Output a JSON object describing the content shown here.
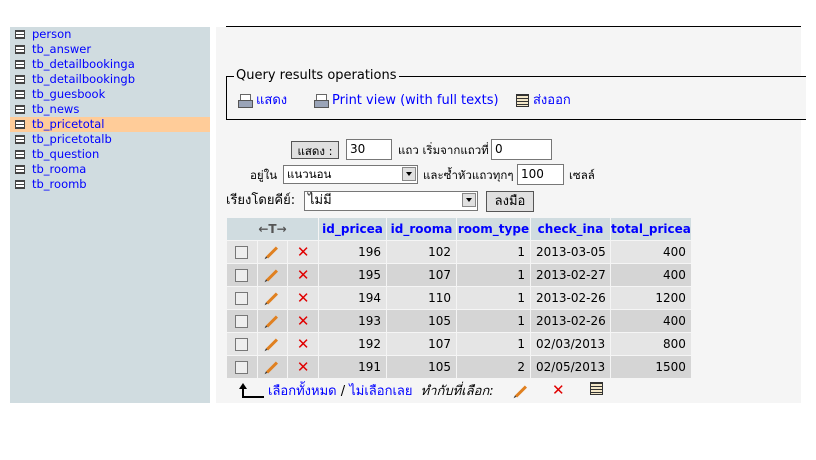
{
  "sidebar": {
    "items": [
      {
        "label": "person"
      },
      {
        "label": "tb_answer"
      },
      {
        "label": "tb_detailbookinga"
      },
      {
        "label": "tb_detailbookingb"
      },
      {
        "label": "tb_guesbook"
      },
      {
        "label": "tb_news"
      },
      {
        "label": "tb_pricetotal",
        "active": true
      },
      {
        "label": "tb_pricetotalb"
      },
      {
        "label": "tb_question"
      },
      {
        "label": "tb_rooma"
      },
      {
        "label": "tb_roomb"
      }
    ]
  },
  "query_ops": {
    "legend": "Query results operations",
    "links": [
      {
        "label": "แสดง",
        "icon": "print-icon"
      },
      {
        "label": "Print view (with full texts)",
        "icon": "print-icon"
      },
      {
        "label": "ส่งออก",
        "icon": "export-icon"
      }
    ]
  },
  "controls": {
    "show_button": "แสดง :",
    "rows_value": "30",
    "rows_label": "แถว เริ่มจากแถวที่",
    "start_value": "0",
    "mode_label": "อยู่ใน",
    "mode_value": "แนวนอน",
    "repeat_label": "และซ้ำหัวแถวทุกๆ",
    "repeat_value": "100",
    "cells_label": "เซลล์",
    "sort_label": "เรียงโดยคีย์:",
    "sort_value": "ไม่มี",
    "go_button": "ลงมือ"
  },
  "table": {
    "nav_arrows": "←T→",
    "columns": [
      "id_pricea",
      "id_rooma",
      "room_type",
      "check_ina",
      "total_pricea"
    ],
    "rows": [
      [
        "196",
        "102",
        "1",
        "2013-03-05",
        "400"
      ],
      [
        "195",
        "107",
        "1",
        "2013-02-27",
        "400"
      ],
      [
        "194",
        "110",
        "1",
        "2013-02-26",
        "1200"
      ],
      [
        "193",
        "105",
        "1",
        "2013-02-26",
        "400"
      ],
      [
        "192",
        "107",
        "1",
        "02/03/2013",
        "800"
      ],
      [
        "191",
        "105",
        "2",
        "02/05/2013",
        "1500"
      ]
    ]
  },
  "bottom": {
    "check_all": "เลือกทั้งหมด",
    "separator": " / ",
    "uncheck_all": "ไม่เลือกเลย",
    "with_selected": "ทำกับที่เลือก:"
  },
  "colors": {
    "link": "#0000ff",
    "sidebar_bg": "#d0dce0",
    "active_item": "#ffcc99",
    "delete": "#e00000"
  }
}
